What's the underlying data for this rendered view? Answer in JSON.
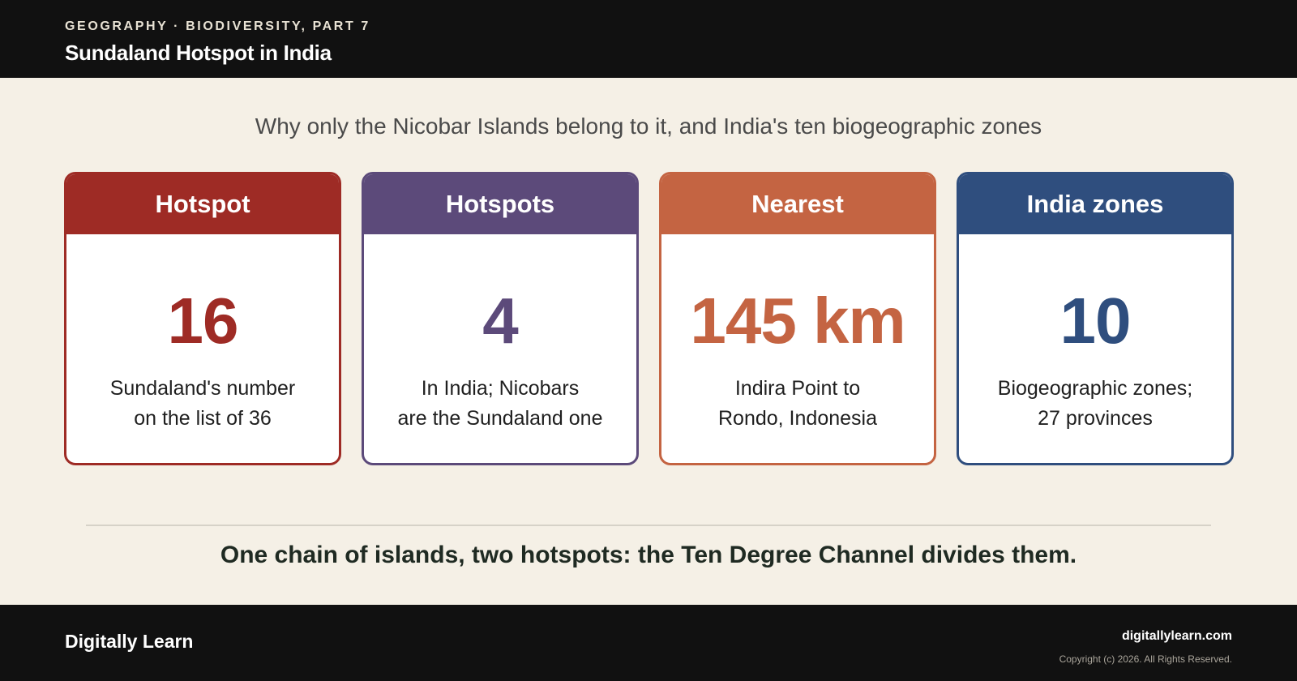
{
  "header": {
    "kicker": "GEOGRAPHY · BIODIVERSITY, PART 7",
    "title": "Sundaland Hotspot in India"
  },
  "subtitle": "Why only the Nicobar Islands belong to it, and India's ten biogeographic zones",
  "cards": [
    {
      "label": "Hotspot",
      "value": "16",
      "desc_line1": "Sundaland's number",
      "desc_line2": "on the list of 36",
      "color": "#9e2b25"
    },
    {
      "label": "Hotspots",
      "value": "4",
      "desc_line1": "In India; Nicobars",
      "desc_line2": "are the Sundaland one",
      "color": "#5c4a7a"
    },
    {
      "label": "Nearest",
      "value": "145 km",
      "desc_line1": "Indira Point to",
      "desc_line2": "Rondo, Indonesia",
      "color": "#c46442"
    },
    {
      "label": "India zones",
      "value": "10",
      "desc_line1": "Biogeographic zones;",
      "desc_line2": "27 provinces",
      "color": "#2f4e7e"
    }
  ],
  "takeaway": "One chain of islands, two hotspots: the Ten Degree Channel divides them.",
  "footer": {
    "brand": "Digitally Learn",
    "site": "digitallylearn.com",
    "copyright": "Copyright (c) 2026. All Rights Reserved."
  }
}
